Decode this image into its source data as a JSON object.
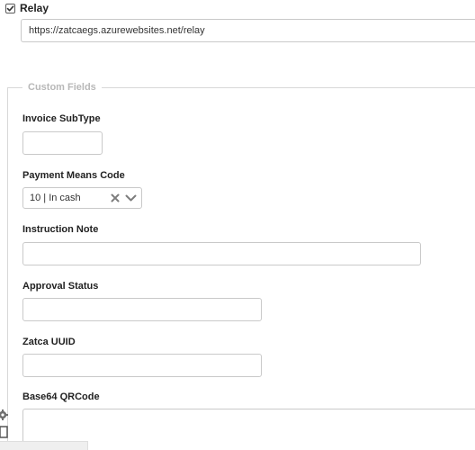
{
  "relay": {
    "label": "Relay",
    "checked": true,
    "url_value": "https://zatcaegs.azurewebsites.net/relay"
  },
  "custom_fields": {
    "legend": "Custom Fields",
    "invoice_subtype": {
      "label": "Invoice SubType",
      "value": ""
    },
    "payment_means_code": {
      "label": "Payment Means Code",
      "value": "10 | In cash",
      "clear_icon": "close-icon",
      "arrow_icon": "chevron-down-icon"
    },
    "instruction_note": {
      "label": "Instruction Note",
      "value": ""
    },
    "approval_status": {
      "label": "Approval Status",
      "value": ""
    },
    "zatca_uuid": {
      "label": "Zatca UUID",
      "value": ""
    },
    "base64_qrcode": {
      "label": "Base64 QRCode",
      "value": ""
    }
  },
  "colors": {
    "label_text": "#222222",
    "legend_text": "#b8b8b8",
    "input_border": "#c9c9c9",
    "select_icon": "#8a8a8a"
  },
  "icons": {
    "edge_top": "gear-icon",
    "edge_bottom": "document-icon"
  }
}
